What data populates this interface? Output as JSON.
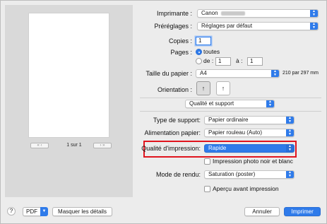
{
  "preview": {
    "page_label": "1 sur 1",
    "first": "«",
    "prev": "‹",
    "next": "›",
    "last": "»"
  },
  "printer": {
    "label": "Imprimante :",
    "value": "Canon"
  },
  "presets": {
    "label": "Préréglages :",
    "value": "Réglages par défaut"
  },
  "copies": {
    "label": "Copies :",
    "value": "1"
  },
  "pages": {
    "label": "Pages :",
    "all_label": "toutes",
    "from_label": "de :",
    "from_value": "1",
    "to_label": "à :",
    "to_value": "1"
  },
  "paper_size": {
    "label": "Taille du papier :",
    "value": "A4",
    "dims": "210 par 297 mm"
  },
  "orientation": {
    "label": "Orientation :",
    "portrait_glyph": "↑",
    "landscape_glyph": "↑"
  },
  "panel": {
    "value": "Qualité et support"
  },
  "media_type": {
    "label": "Type de support:",
    "value": "Papier ordinaire"
  },
  "paper_source": {
    "label": "Alimentation papier:",
    "value": "Papier rouleau (Auto)"
  },
  "quality": {
    "label": "Qualité d'impression:",
    "value": "Rapide"
  },
  "bw_photo": {
    "label": "Impression photo noir et blanc"
  },
  "render_mode": {
    "label": "Mode de rendu:",
    "value": "Saturation (poster)"
  },
  "preview_check": {
    "label": "Aperçu avant impression"
  },
  "footer": {
    "help": "?",
    "pdf": "PDF",
    "details": "Masquer les détails",
    "cancel": "Annuler",
    "print": "Imprimer"
  },
  "colors": {
    "accent": "#2f7bea",
    "highlight": "#e0141e"
  }
}
